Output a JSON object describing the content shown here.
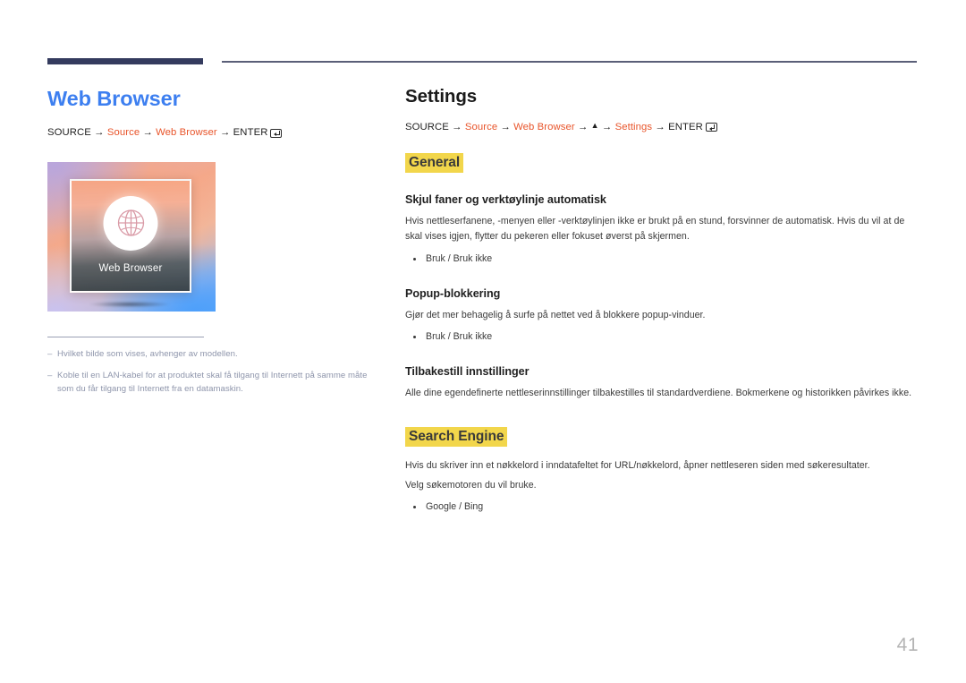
{
  "header": {
    "rule_accent_color": "#343b5e",
    "rule_line_color": "#5a5f78"
  },
  "left": {
    "title": "Web Browser",
    "title_color": "#3d7ff0",
    "path": {
      "prefix": "SOURCE",
      "arrow": " → ",
      "step1": "Source",
      "step2": "Web Browser",
      "enter": "ENTER",
      "enter_icon": "enter-key-icon"
    },
    "thumbnail": {
      "label": "Web Browser",
      "icon": "globe-icon"
    },
    "notes": [
      {
        "dash": "–",
        "text": "Hvilket bilde som vises, avhenger av modellen."
      },
      {
        "dash": "–",
        "text": "Koble til en LAN-kabel for at produktet skal få tilgang til Internett på samme måte som du får tilgang til Internett fra en datamaskin."
      }
    ]
  },
  "right": {
    "title": "Settings",
    "path": {
      "prefix": "SOURCE",
      "arrow": " → ",
      "step1": "Source",
      "step2": "Web Browser",
      "up_arrow": "▲",
      "step3": "Settings",
      "enter": "ENTER",
      "enter_icon": "enter-key-icon"
    },
    "sections": [
      {
        "heading": "General",
        "heading_highlight_color": "#f2d64b",
        "items": [
          {
            "title": "Skjul faner og verktøylinje automatisk",
            "description": "Hvis nettleserfanene, -menyen eller -verktøylinjen ikke er brukt på en stund, forsvinner de automatisk. Hvis du vil at de skal vises igjen, flytter du pekeren eller fokuset øverst på skjermen.",
            "options": [
              "Bruk / Bruk ikke"
            ]
          },
          {
            "title": "Popup-blokkering",
            "description": "Gjør det mer behagelig å surfe på nettet ved å blokkere popup-vinduer.",
            "options": [
              "Bruk / Bruk ikke"
            ]
          },
          {
            "title": "Tilbakestill innstillinger",
            "description": "Alle dine egendefinerte nettleserinnstillinger tilbakestilles til standardverdiene. Bokmerkene og historikken påvirkes ikke.",
            "options": []
          }
        ]
      },
      {
        "heading": "Search Engine",
        "heading_highlight_color": "#f2d64b",
        "description_1": "Hvis du skriver inn et nøkkelord i inndatafeltet for URL/nøkkelord, åpner nettleseren siden med søkeresultater.",
        "description_2": "Velg søkemotoren du vil bruke.",
        "options": [
          "Google / Bing"
        ]
      }
    ]
  },
  "footer": {
    "page_number": "41"
  }
}
